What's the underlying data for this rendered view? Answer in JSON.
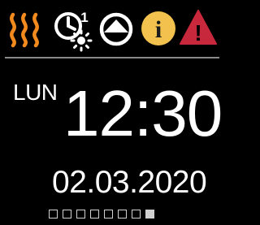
{
  "status_bar": {
    "icons": [
      "heat-icon",
      "timer-icon",
      "boiler-icon",
      "info-icon",
      "warning-icon"
    ],
    "timer_badge": "1",
    "info_glyph": "i",
    "warning_glyph": "!"
  },
  "colors": {
    "heat": "#f28a1e",
    "info": "#f2c14e",
    "warning": "#c8283c",
    "text": "#ffffff",
    "separator": "#8a8a8a"
  },
  "clock": {
    "day": "LUN",
    "time": "12:30",
    "date": "02.03.2020"
  },
  "pager": {
    "count": 8,
    "active_index": 7
  }
}
